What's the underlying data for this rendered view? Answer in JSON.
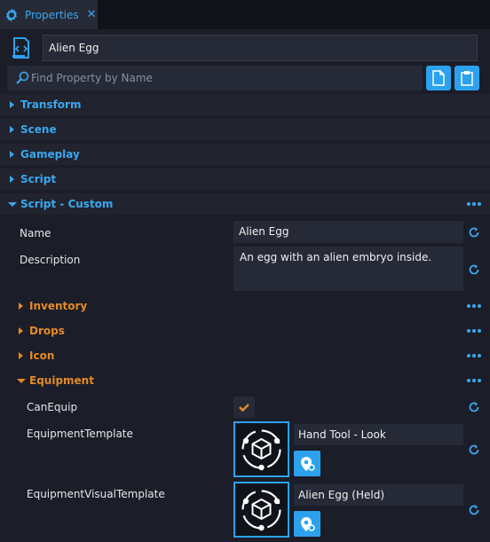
{
  "tab": {
    "title": "Properties",
    "close_icon": "close-icon",
    "icon": "gear-icon"
  },
  "object": {
    "name": "Alien Egg",
    "icon": "script-file-icon"
  },
  "search": {
    "placeholder": "Find Property by Name",
    "buttons": [
      "copy-icon",
      "paste-icon"
    ]
  },
  "sections": [
    {
      "label": "Transform",
      "expanded": false
    },
    {
      "label": "Scene",
      "expanded": false
    },
    {
      "label": "Gameplay",
      "expanded": false
    },
    {
      "label": "Script",
      "expanded": false
    },
    {
      "label": "Script - Custom",
      "expanded": true
    }
  ],
  "custom": {
    "name_label": "Name",
    "name_value": "Alien Egg",
    "description_label": "Description",
    "description_value": "An egg with an alien embryo inside.",
    "groups": [
      {
        "label": "Inventory",
        "expanded": false
      },
      {
        "label": "Drops",
        "expanded": false
      },
      {
        "label": "Icon",
        "expanded": false
      },
      {
        "label": "Equipment",
        "expanded": true
      }
    ],
    "equipment": {
      "can_equip_label": "CanEquip",
      "can_equip_checked": true,
      "equipment_template_label": "EquipmentTemplate",
      "equipment_template_value": "Hand Tool - Look",
      "visual_template_label": "EquipmentVisualTemplate",
      "visual_template_value": "Alien Egg (Held)"
    }
  },
  "colors": {
    "accent_blue": "#2ca2ee",
    "accent_orange": "#e48a25",
    "background": "#1b1e29",
    "field": "#262a37"
  }
}
